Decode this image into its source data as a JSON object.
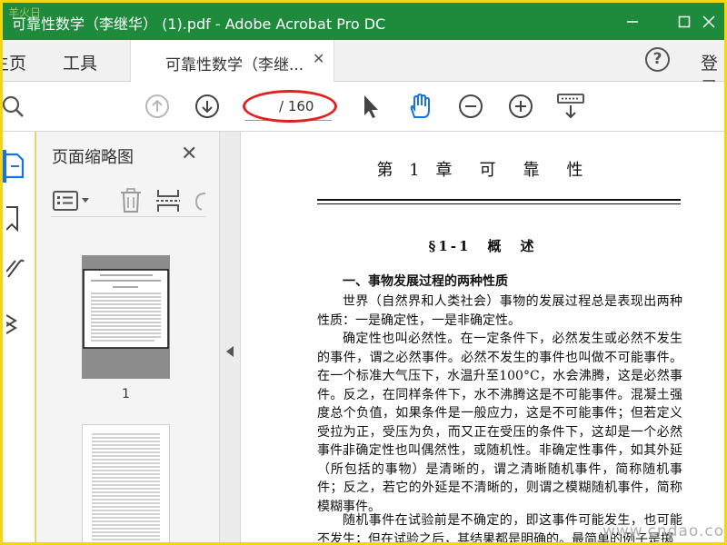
{
  "app": {
    "window_title": "可靠性数学（李继华） (1).pdf - Adobe Acrobat Pro DC",
    "watermark_top": "羊火日"
  },
  "tabs": {
    "home": "主页",
    "tools": "工具",
    "document": "可靠性数学（李继...",
    "login": "登录"
  },
  "toolbar": {
    "page_total": "/ 160"
  },
  "thumbnails": {
    "panel_title": "页面缩略图",
    "page1_label": "1"
  },
  "document": {
    "chapter_title": "第 1 章　可　靠　性",
    "section_title": "§1-1　概　述",
    "heading1": "一、事物发展过程的两种性质",
    "paragraphs": [
      "世界（自然界和人类社会）事物的发展过程总是表现出两种性质：一是确定性，一是非确定性。",
      "确定性也叫必然性。在一定条件下，必然发生或必然不发生的事件，谓之必然事件。必然不发生的事件也叫做不可能事件。在一个标准大气压下，水温升至100°C，水会沸腾，这是必然事件。反之，在同样条件下，水不沸腾这是不可能事件。混凝土强度总个负值，如果条件是一般应力，这是不可能事件；但若定义受拉为正，受压为负，而又正在受压的条件下，这却是一个必然事件。",
      "非确定性也叫偶然性，或随机性。非确定性事件，如其外延（所包括的事物）是清晰的，谓之清晰随机事件，简称随机事件；反之，若它的外延是不清晰的，则谓之模糊随机事件，简称模糊事件。",
      "随机事件在试验前是不确定的，即这事件可能发生，也可能不发生；但在试验之后，其结果都是明确的。最简单的例子是掷"
    ]
  },
  "watermark": "www.cndao.com",
  "colors": {
    "titlebar": "#1e8a3c",
    "frame": "#f4d60a",
    "accent": "#1473e6",
    "highlight_oval": "#e22020"
  }
}
